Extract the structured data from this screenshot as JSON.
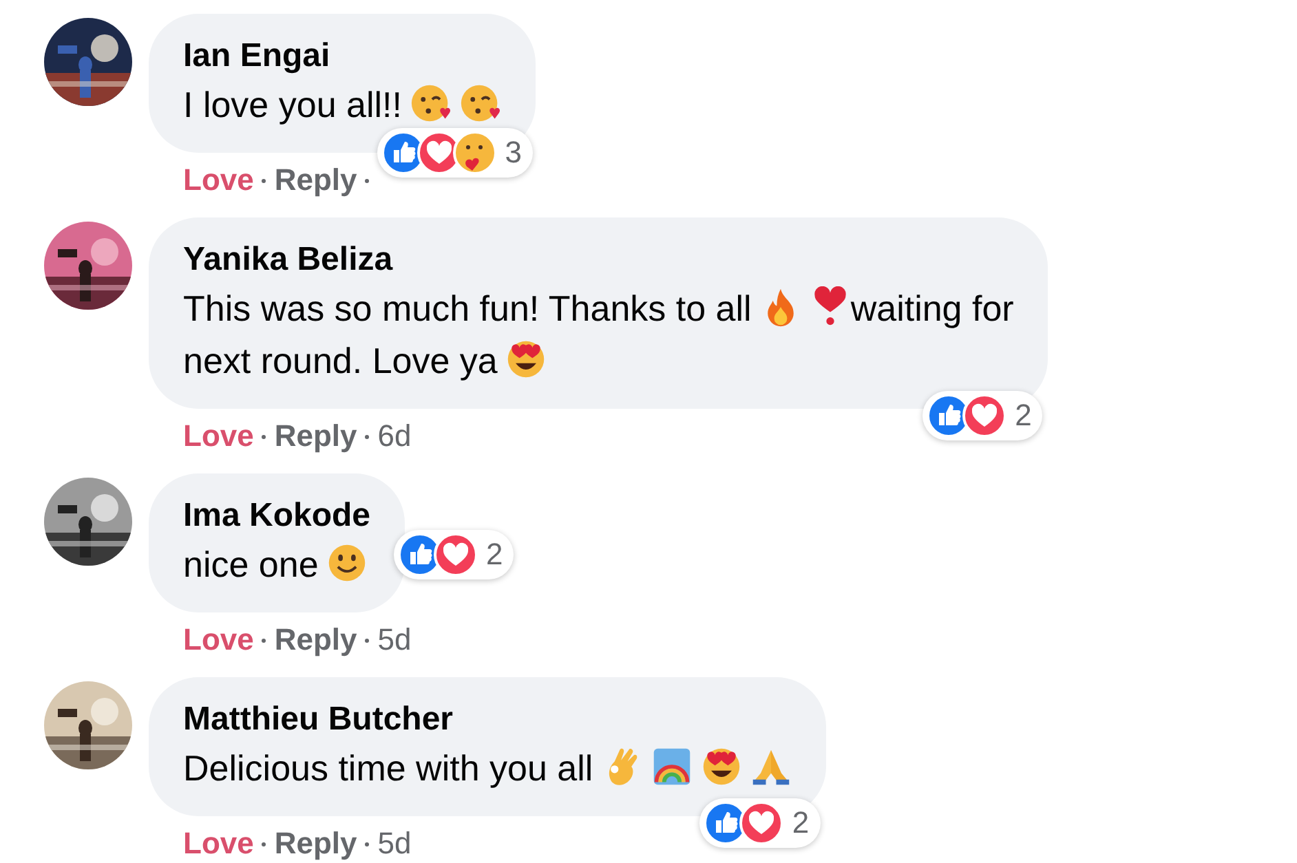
{
  "comments": [
    {
      "author": "Ian Engai",
      "avatar": {
        "kind": "picture"
      },
      "lines": [
        [
          {
            "kind": "text",
            "text": "I love you all!!"
          },
          {
            "kind": "kiss"
          },
          {
            "kind": "kiss"
          }
        ]
      ],
      "reactions": {
        "kind": "corner",
        "icons": [
          {
            "kind": "like"
          },
          {
            "kind": "love"
          },
          {
            "kind": "care"
          }
        ],
        "count": "3"
      },
      "actions": {
        "love": "Love",
        "reply": "Reply",
        "loved": true
      }
    },
    {
      "author": "Yanika Beliza",
      "avatar": {
        "kind": "picture"
      },
      "lines": [
        [
          {
            "kind": "text",
            "text": "This was so much fun! Thanks to all"
          },
          {
            "kind": "fire"
          },
          {
            "kind": "heart-exclamation"
          },
          {
            "kind": "text",
            "text": "waiting for"
          }
        ],
        [
          {
            "kind": "text",
            "text": "next round. Love ya"
          },
          {
            "kind": "heart-eyes"
          }
        ]
      ],
      "reactions": {
        "kind": "below",
        "icons": [
          {
            "kind": "like"
          },
          {
            "kind": "love"
          }
        ],
        "count": "2"
      },
      "actions": {
        "love": "Love",
        "reply": "Reply",
        "time": "6d",
        "loved": true
      }
    },
    {
      "author": "Ima Kokode",
      "avatar": {
        "kind": "picture"
      },
      "lines": [
        [
          {
            "kind": "text",
            "text": "nice one"
          },
          {
            "kind": "smile"
          }
        ]
      ],
      "reactions": {
        "kind": "beside",
        "icons": [
          {
            "kind": "like"
          },
          {
            "kind": "love"
          }
        ],
        "count": "2"
      },
      "actions": {
        "love": "Love",
        "reply": "Reply",
        "time": "5d",
        "loved": true
      }
    },
    {
      "author": "Matthieu Butcher",
      "avatar": {
        "kind": "picture"
      },
      "lines": [
        [
          {
            "kind": "text",
            "text": "Delicious time with you all"
          },
          {
            "kind": "ok-hand"
          },
          {
            "kind": "rainbow"
          },
          {
            "kind": "heart-eyes"
          },
          {
            "kind": "pray"
          }
        ]
      ],
      "reactions": {
        "kind": "below",
        "icons": [
          {
            "kind": "like"
          },
          {
            "kind": "love"
          }
        ],
        "count": "2"
      },
      "actions": {
        "love": "Love",
        "reply": "Reply",
        "time": "5d",
        "loved": true
      }
    }
  ]
}
